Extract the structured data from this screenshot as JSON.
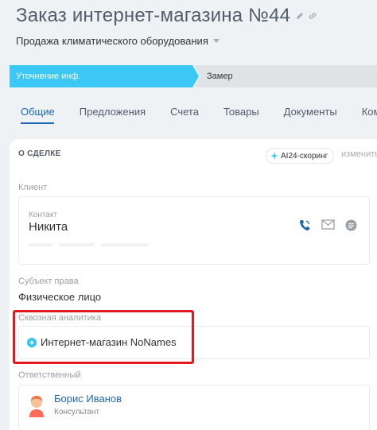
{
  "header": {
    "title": "Заказ интернет-магазина №44",
    "pipeline": "Продажа климатического оборудования"
  },
  "stages": [
    {
      "label": "Уточнение инф.",
      "active": true
    },
    {
      "label": "Замер",
      "active": false
    }
  ],
  "stage_colors": {
    "active": "#3bc8f5",
    "inactive": "#dfe3e6"
  },
  "tabs": [
    {
      "label": "Общие",
      "active": true
    },
    {
      "label": "Предложения"
    },
    {
      "label": "Счета"
    },
    {
      "label": "Товары"
    },
    {
      "label": "Документы"
    },
    {
      "label": "Комм"
    }
  ],
  "deal": {
    "section_title": "О СДЕЛКЕ",
    "ai_badge": "AI24-скоринг",
    "change_link": "изменить",
    "client_label": "Клиент",
    "contact": {
      "label": "Контакт",
      "name": "Никита",
      "icons": [
        "phone-icon",
        "mail-icon",
        "chat-icon"
      ]
    },
    "subject": {
      "label": "Субъект права",
      "value": "Физическое лицо"
    },
    "analytics": {
      "label": "Сквозная аналитика",
      "value": "Интернет-магазин NoNames"
    },
    "responsible": {
      "label": "Ответственный",
      "name": "Борис Иванов",
      "role": "Консультант"
    }
  },
  "colors": {
    "accent": "#2067b0",
    "highlight": "#e4191f"
  }
}
